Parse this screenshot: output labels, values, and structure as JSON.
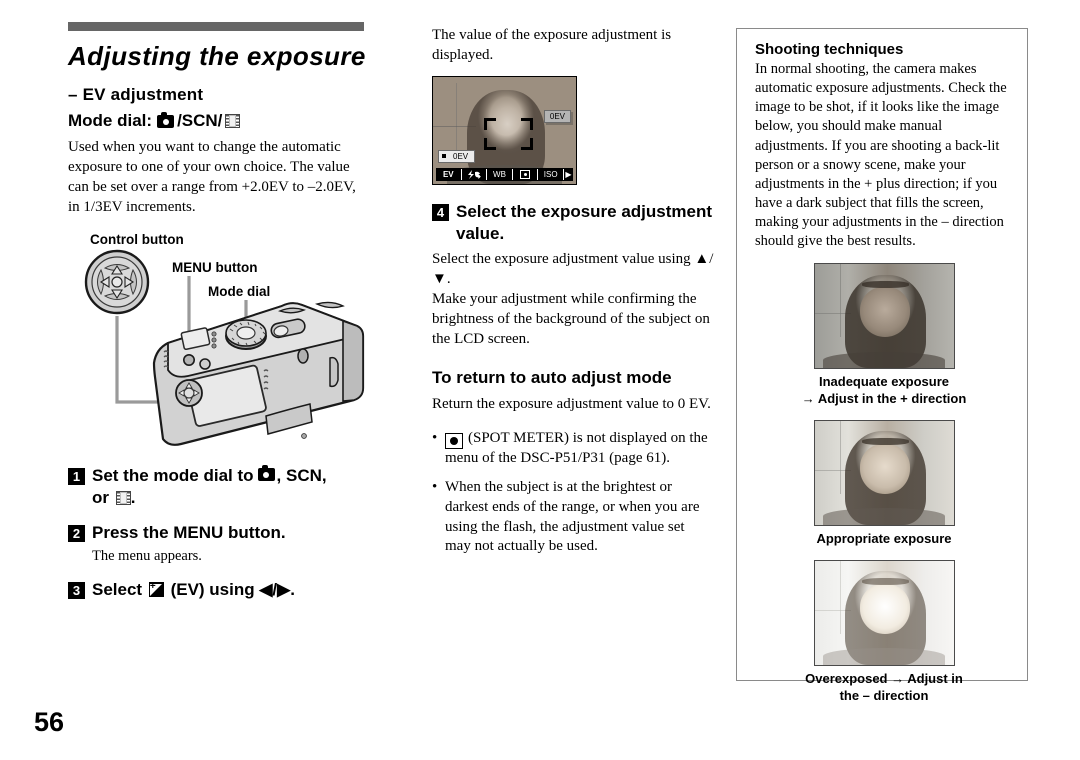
{
  "page": {
    "number": "56"
  },
  "left": {
    "title": "Adjusting the exposure",
    "subhead": "– EV adjustment",
    "mode_dial_label": "Mode dial:",
    "mode_dial_scn": "/SCN/",
    "intro": "Used when you want to change the automatic exposure to one of your own choice. The value can be set over a range from +2.0EV to –2.0EV, in 1/3EV increments.",
    "diagram": {
      "control_button_label": "Control button",
      "menu_button_label": "MENU button",
      "mode_dial_label": "Mode dial"
    },
    "steps": [
      {
        "num": "1",
        "text_a": "Set the mode dial to",
        "text_b": ", SCN,",
        "text_c": "or",
        "text_d": "."
      },
      {
        "num": "2",
        "text": "Press the MENU button.",
        "note": "The menu appears."
      },
      {
        "num": "3",
        "text_a": "Select",
        "text_b": "(EV) using ◀/▶."
      }
    ]
  },
  "middle": {
    "lead": "The value of the exposure adjustment is displayed.",
    "lcd": {
      "ev_value_top": "0EV",
      "ev_value_bottom": "0EV",
      "menu": [
        "EV",
        "flash-icon",
        "WB",
        "spot-meter-icon",
        "ISO"
      ],
      "menu_arrow": "▶"
    },
    "step4": {
      "num": "4",
      "heading": "Select the exposure adjustment value.",
      "body_line1": "Select the exposure adjustment value using ▲/▼.",
      "body_line2": "Make your adjustment while confirming the brightness of the background of the subject on the LCD screen."
    },
    "return_head": "To return to auto adjust mode",
    "return_body": "Return the exposure adjustment value to 0 EV.",
    "bullets": [
      {
        "icon": "spot-meter-icon",
        "text": "(SPOT METER) is not displayed on the menu of the DSC-P51/P31 (page 61)."
      },
      {
        "icon": "",
        "text": "When the subject is at the brightest or darkest ends of the range, or when you are using the flash, the adjustment value set may not actually be used."
      }
    ]
  },
  "right": {
    "heading": "Shooting techniques",
    "body": "In normal shooting, the camera makes automatic exposure adjustments. Check the image to be shot, if it looks like the image below, you should make manual adjustments. If you are shooting a back-lit person or a snowy scene, make your adjustments in the + plus direction; if you have a dark subject that fills the screen, making your adjustments in the – direction should give the best results.",
    "examples": [
      {
        "exposure": "dark",
        "caption_line1": "Inadequate exposure",
        "caption_line2": "→ Adjust in the + direction"
      },
      {
        "exposure": "appropriate",
        "caption_line1": "Appropriate exposure",
        "caption_line2": ""
      },
      {
        "exposure": "bright",
        "caption_line1": "Overexposed → Adjust in",
        "caption_line2": "the – direction"
      }
    ]
  },
  "colors": {
    "rule": "#666666",
    "box_border": "#8a8a8a",
    "text": "#000000"
  }
}
